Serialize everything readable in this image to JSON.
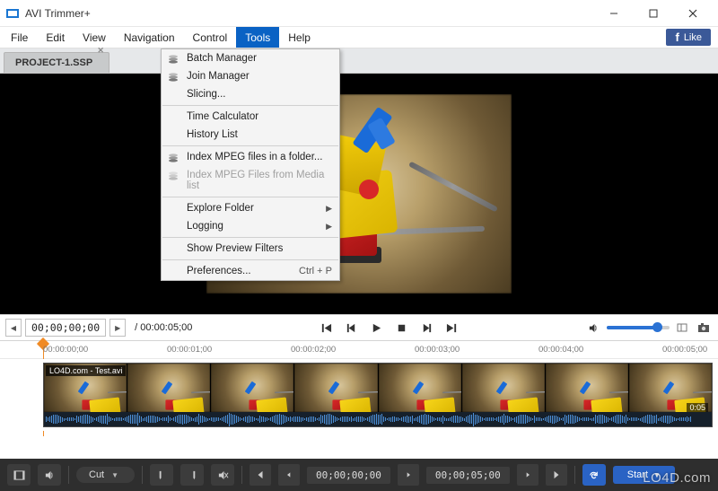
{
  "window": {
    "title": "AVI Trimmer+"
  },
  "menubar": {
    "items": [
      "File",
      "Edit",
      "View",
      "Navigation",
      "Control",
      "Tools",
      "Help"
    ],
    "active_index": 5,
    "like_label": "Like"
  },
  "tools_menu": {
    "items": [
      {
        "label": "Batch Manager",
        "icon": "stack"
      },
      {
        "label": "Join Manager",
        "icon": "stack"
      },
      {
        "label": "Slicing...",
        "icon": ""
      },
      {
        "sep": true
      },
      {
        "label": "Time Calculator",
        "icon": ""
      },
      {
        "label": "History List",
        "icon": ""
      },
      {
        "sep": true
      },
      {
        "label": "Index MPEG files in a folder...",
        "icon": "stack"
      },
      {
        "label": "Index MPEG Files from Media list",
        "icon": "stack",
        "disabled": true
      },
      {
        "sep": true
      },
      {
        "label": "Explore Folder",
        "submenu": true
      },
      {
        "label": "Logging",
        "submenu": true
      },
      {
        "sep": true
      },
      {
        "label": "Show Preview Filters",
        "icon": ""
      },
      {
        "sep": true
      },
      {
        "label": "Preferences...",
        "shortcut": "Ctrl + P"
      }
    ]
  },
  "tab": {
    "name": "PROJECT-1.SSP"
  },
  "transport": {
    "current": "00;00;00;00",
    "total": "/ 00:00:05;00"
  },
  "ruler": {
    "ticks": [
      "00:00:00;00",
      "00:00:01;00",
      "00:00:02;00",
      "00:00:03;00",
      "00:00:04;00",
      "00:00:05;00"
    ]
  },
  "clip": {
    "label": "LO4D.com - Test.avi",
    "duration": "0:05"
  },
  "bottombar": {
    "mode": "Cut",
    "time_in": "00;00;00;00",
    "time_out": "00;00;05;00",
    "start": "Start"
  },
  "watermark": "LO4D.com"
}
